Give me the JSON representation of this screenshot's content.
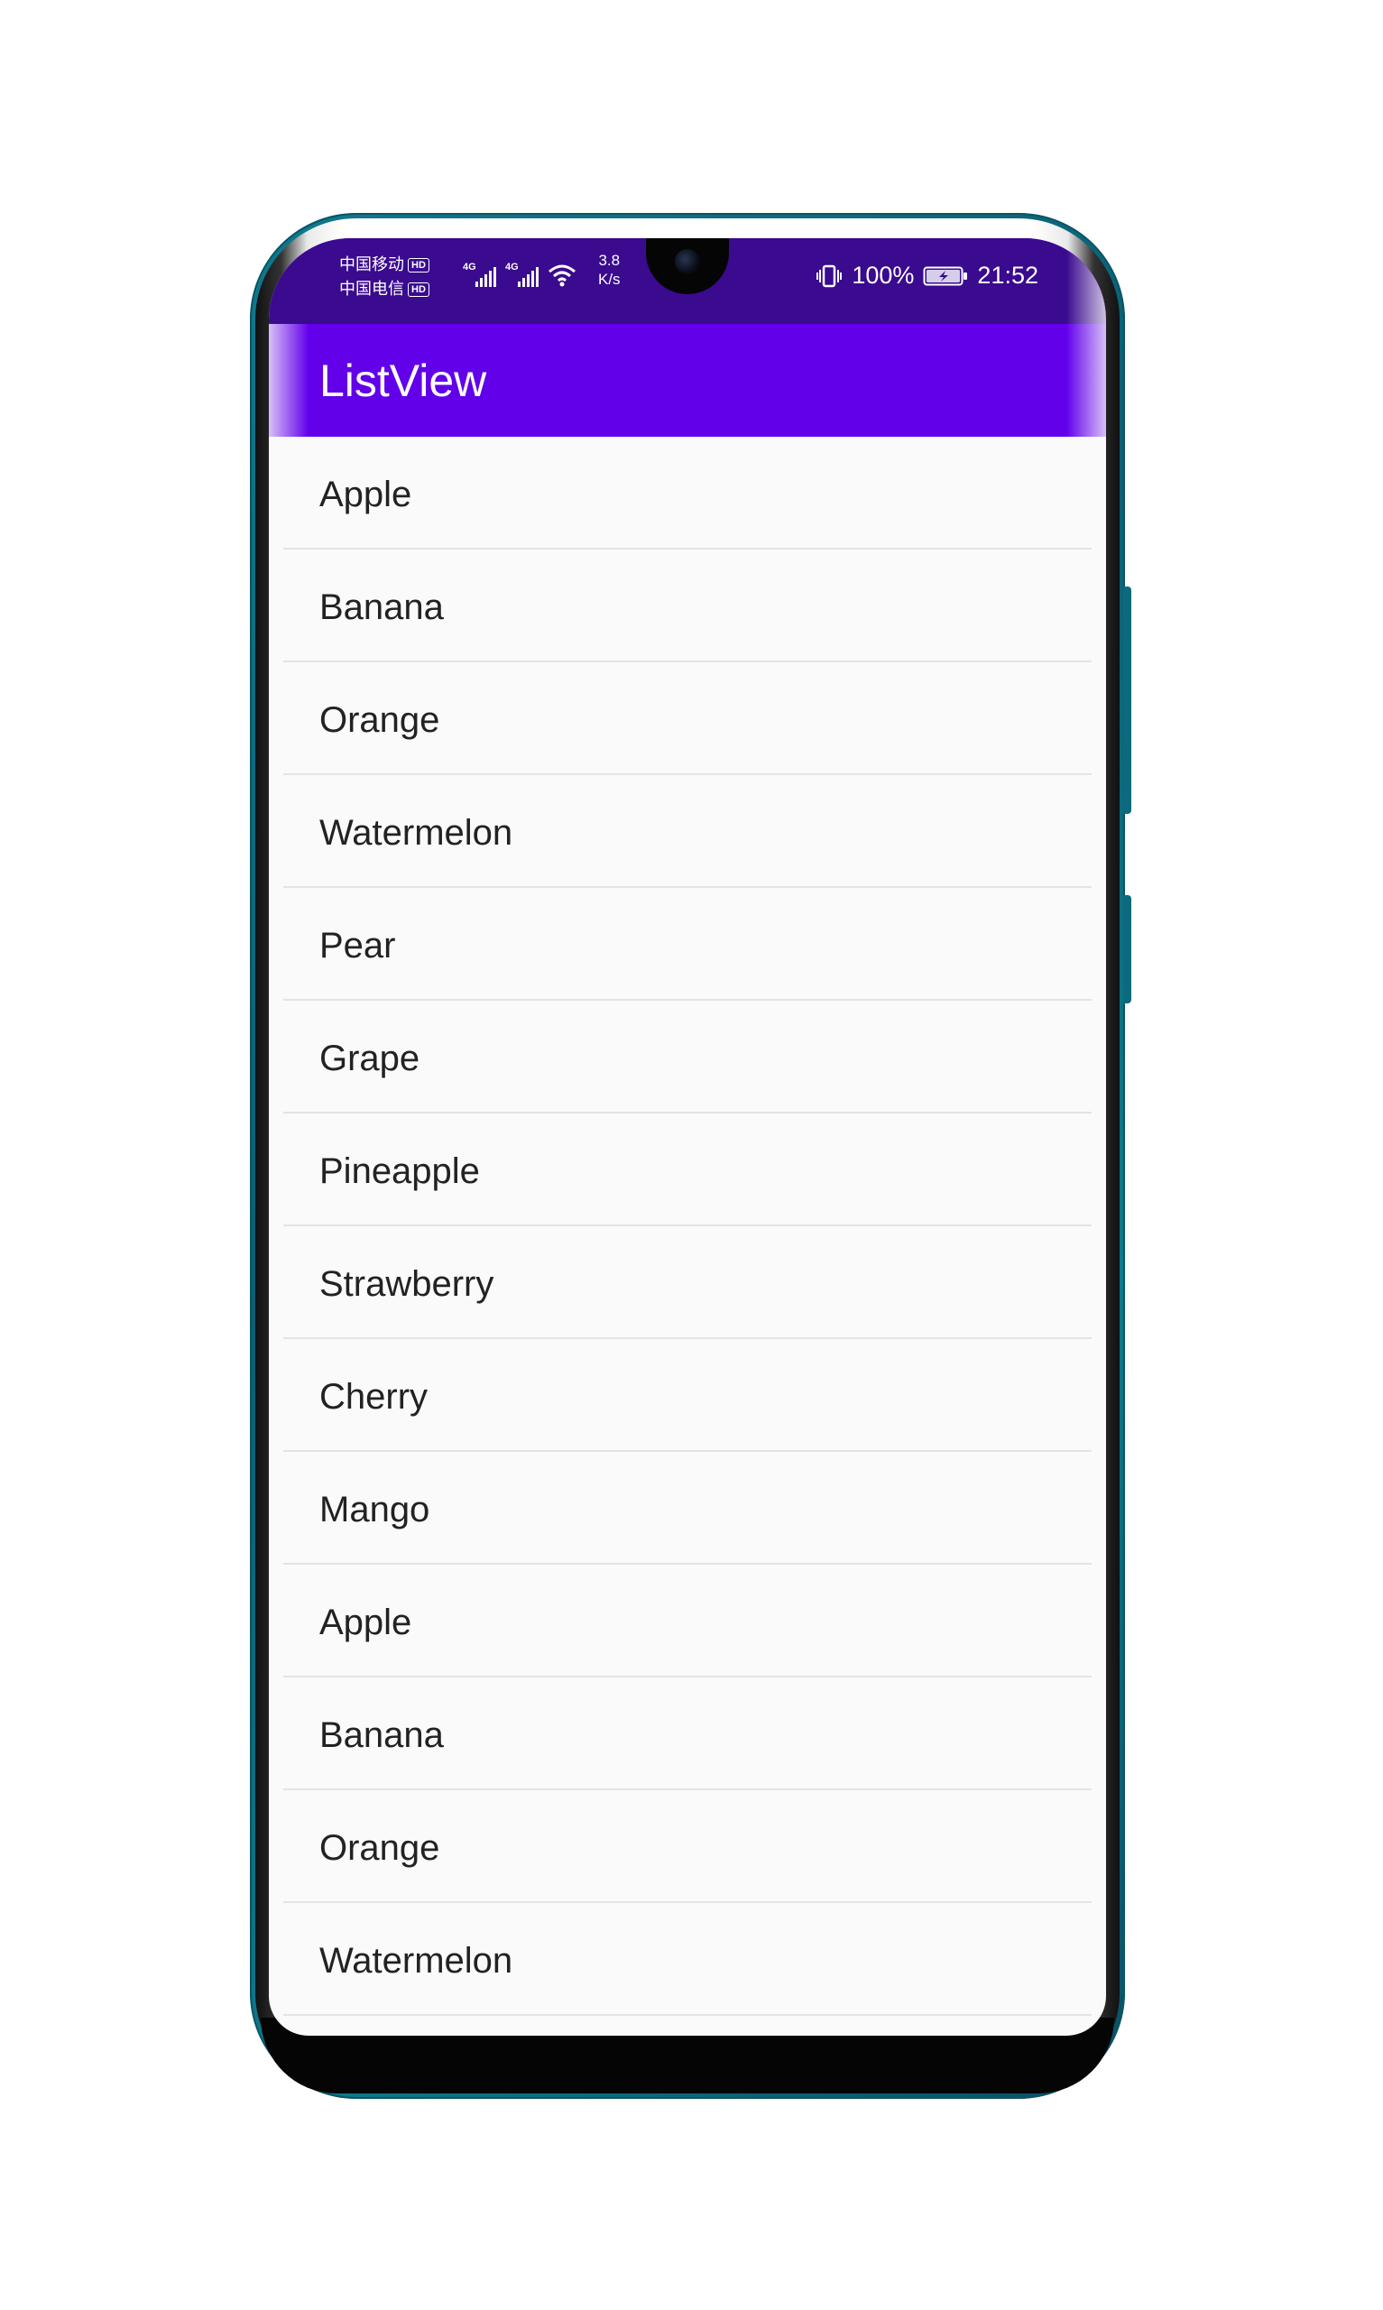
{
  "status_bar": {
    "carrier_1": "中国移动",
    "carrier_2": "中国电信",
    "hd_badge": "HD",
    "network_1": "4G",
    "network_2": "4G",
    "speed_value": "3.8",
    "speed_unit": "K/s",
    "battery_percent": "100%",
    "time": "21:52"
  },
  "app_bar": {
    "title": "ListView",
    "color": "#6200ea"
  },
  "list": {
    "items": [
      "Apple",
      "Banana",
      "Orange",
      "Watermelon",
      "Pear",
      "Grape",
      "Pineapple",
      "Strawberry",
      "Cherry",
      "Mango",
      "Apple",
      "Banana",
      "Orange",
      "Watermelon"
    ]
  },
  "icons": {
    "signal": "signal-bars-icon",
    "wifi": "wifi-icon",
    "vibrate": "vibrate-icon",
    "battery": "battery-charging-icon",
    "camera": "front-camera-icon"
  }
}
